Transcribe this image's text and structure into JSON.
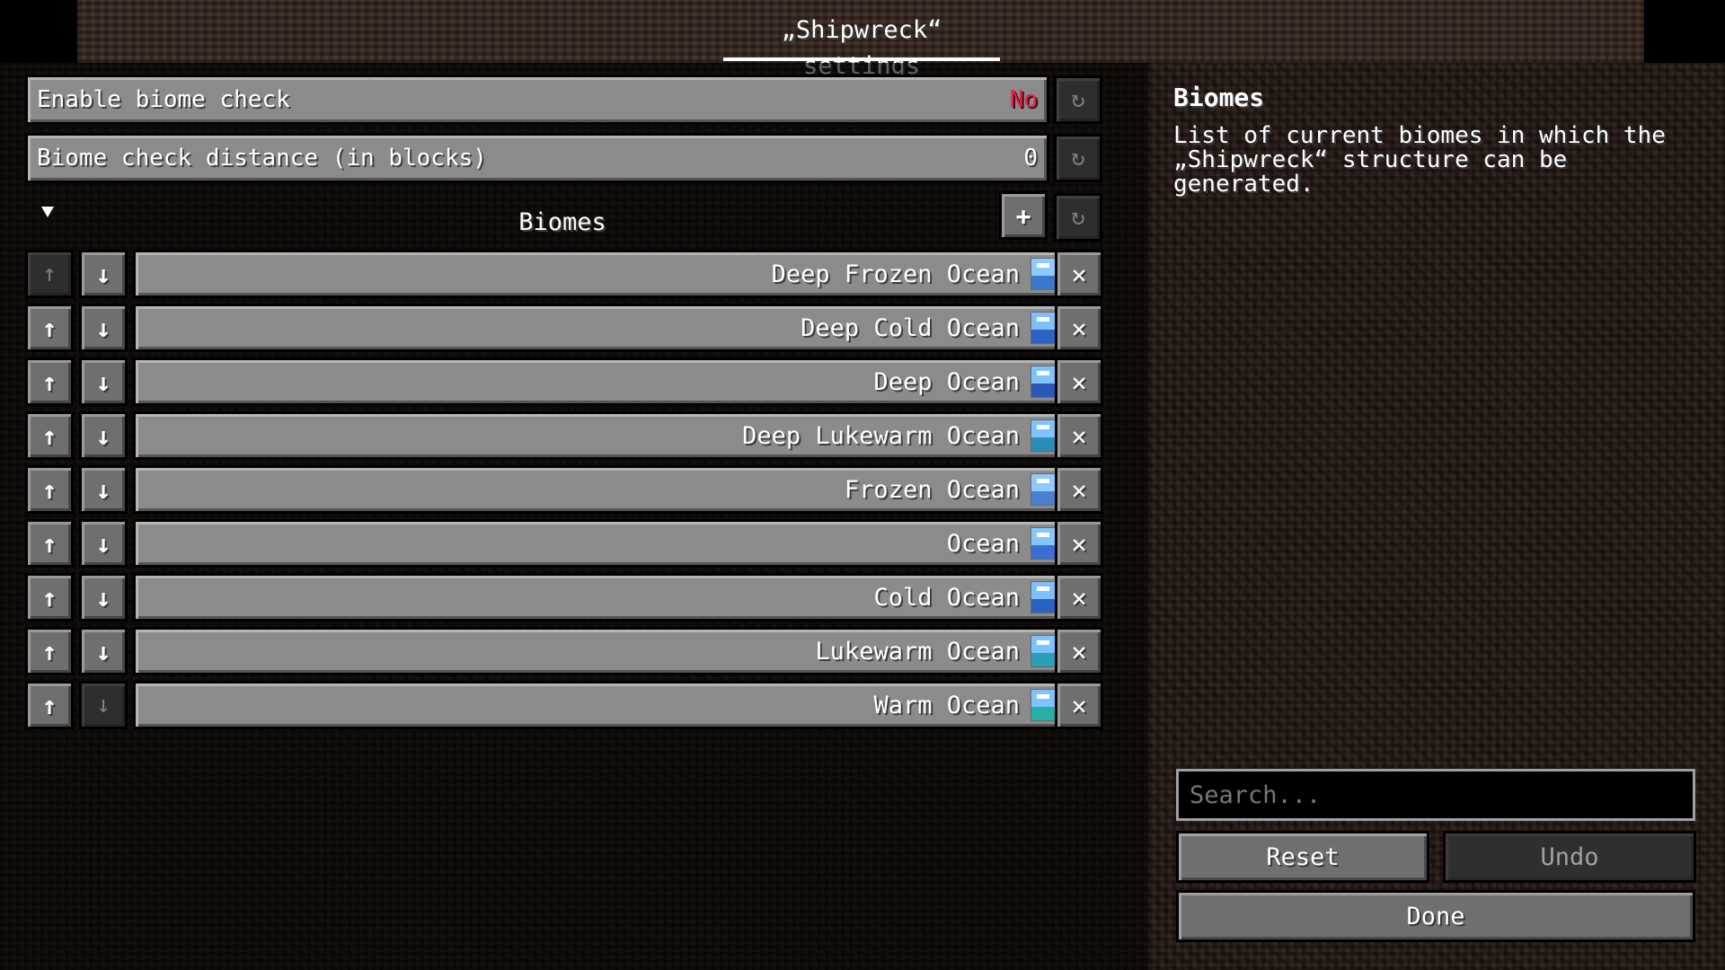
{
  "window": {
    "title": "„Shipwreck“ settings"
  },
  "settings": {
    "enable_biome_check": {
      "label": "Enable biome check",
      "value": "No"
    },
    "biome_check_distance": {
      "label": "Biome check distance (in blocks)",
      "value": "0"
    }
  },
  "section": {
    "title": "Biomes",
    "add_label": "+",
    "reset_icon": "↻"
  },
  "biomes": [
    {
      "name": "Deep Frozen Ocean",
      "icon": "deep-frozen-ocean-icon",
      "sky": "#8fc9ff",
      "sea": "#3a78c9"
    },
    {
      "name": "Deep Cold Ocean",
      "icon": "deep-cold-ocean-icon",
      "sky": "#7ec0ff",
      "sea": "#2a63c2"
    },
    {
      "name": "Deep Ocean",
      "icon": "deep-ocean-icon",
      "sky": "#7cc3ff",
      "sea": "#2a58b8"
    },
    {
      "name": "Deep Lukewarm Ocean",
      "icon": "deep-lukewarm-ocean-icon",
      "sky": "#7cc3ff",
      "sea": "#2a8fb8"
    },
    {
      "name": "Frozen Ocean",
      "icon": "frozen-ocean-icon",
      "sky": "#8fc9ff",
      "sea": "#4a7fd0"
    },
    {
      "name": "Ocean",
      "icon": "ocean-icon",
      "sky": "#84c7ff",
      "sea": "#3b6fd6"
    },
    {
      "name": "Cold Ocean",
      "icon": "cold-ocean-icon",
      "sky": "#7ec0ff",
      "sea": "#2a63c2"
    },
    {
      "name": "Lukewarm Ocean",
      "icon": "lukewarm-ocean-icon",
      "sky": "#7cc3ff",
      "sea": "#2aa0b8"
    },
    {
      "name": "Warm Ocean",
      "icon": "warm-ocean-icon",
      "sky": "#7cc3ff",
      "sea": "#25b0a8"
    }
  ],
  "controls": {
    "up": "↑",
    "down": "↓",
    "remove": "✕",
    "reset": "↻"
  },
  "description": {
    "title": "Biomes",
    "text": "List of current biomes in which the\n„Shipwreck“ structure can be\ngenerated."
  },
  "search": {
    "placeholder": "Search...",
    "value": ""
  },
  "buttons": {
    "reset": "Reset",
    "undo": "Undo",
    "done": "Done"
  },
  "colors": {
    "value_no": "#e8204a",
    "button_gray": "#8b8b8b"
  }
}
